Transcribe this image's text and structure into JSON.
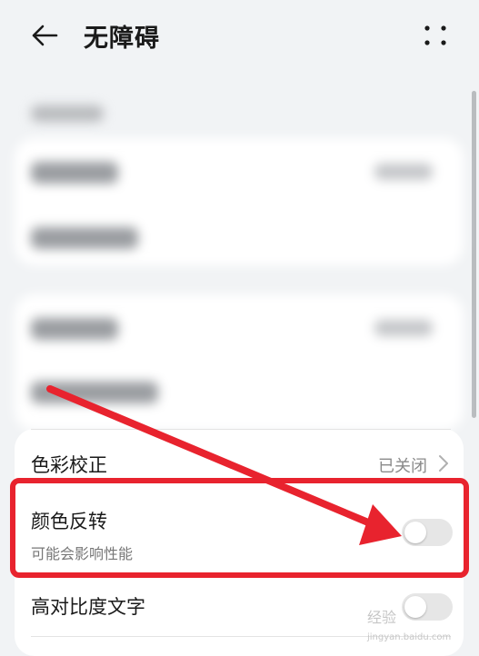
{
  "header": {
    "title": "无障碍",
    "back_icon": "arrow-left-icon",
    "more_icon": "more-dots-icon"
  },
  "settings": {
    "color_correction": {
      "label": "色彩校正",
      "value": "已关闭"
    },
    "color_inversion": {
      "label": "颜色反转",
      "subtitle": "可能会影响性能",
      "enabled": false
    },
    "high_contrast_text": {
      "label": "高对比度文字",
      "enabled": false
    }
  },
  "watermark": {
    "text": "经验",
    "url": "jingyan.baidu.com"
  },
  "colors": {
    "highlight": "#e8232e",
    "background": "#f1f3f5",
    "card": "#ffffff",
    "toggle_off": "#e6e6e6"
  }
}
